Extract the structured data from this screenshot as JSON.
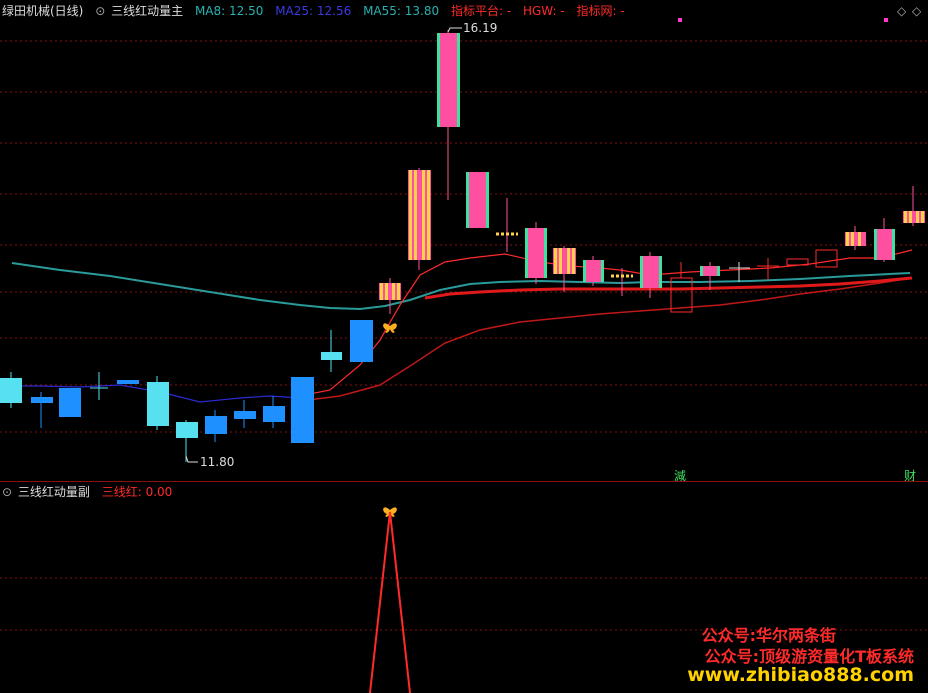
{
  "main_panel": {
    "stock_title": "绿田机械(日线)",
    "indicator_name": "三线红动量主",
    "ma8": "MA8: 12.50",
    "ma25": "MA25: 12.56",
    "ma55": "MA55: 13.80",
    "platform": "指标平台: -",
    "hgw": "HGW: -",
    "net": "指标网: -",
    "high_label": "16.19",
    "low_label": "11.80",
    "marker_jian": "減",
    "marker_cai": "财"
  },
  "sub_panel": {
    "indicator_name": "三线红动量副",
    "value": "三线红: 0.00"
  },
  "watermarks": {
    "line1": "公众号:华尔两条街",
    "line2": "公众号:顶级游资量化T板系统",
    "line3": "www.zhibiao888.com"
  },
  "colors": {
    "up_candle_fill": "#ff4fa0",
    "up_candle_stripe": "#ffd24a",
    "down_candle": "#1e90ff",
    "down_light": "#56e0f0",
    "ma_red": "#ff2a2a",
    "ma_teal": "#2a9a9a",
    "grid": "#8a1010",
    "watermark_red": "#ff2a2a"
  }
}
